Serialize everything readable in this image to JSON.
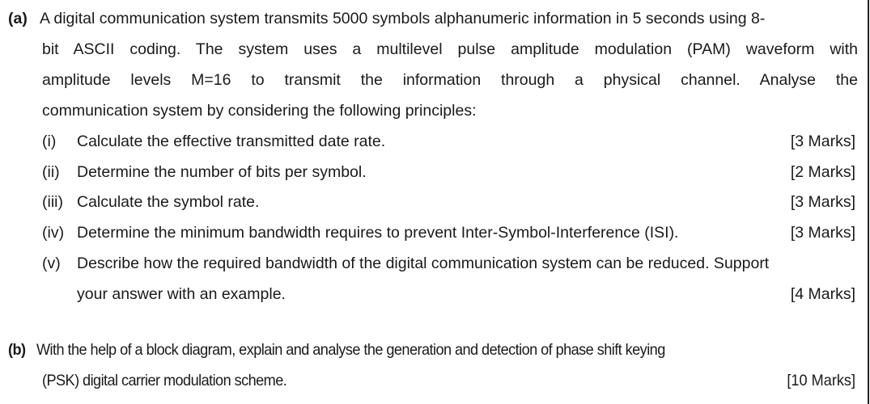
{
  "part_a": {
    "label": "(a)",
    "intro_lines": [
      "A digital communication system transmits 5000 symbols alphanumeric information in 5 seconds using 8-",
      "bit ASCII coding. The system uses a multilevel pulse amplitude modulation (PAM) waveform with",
      "amplitude levels M=16 to transmit the information through a physical channel. Analyse the",
      "communication system by considering the following principles:"
    ],
    "items": [
      {
        "num": "(i)",
        "text": "Calculate the effective transmitted date rate.",
        "marks": "[3 Marks]"
      },
      {
        "num": "(ii)",
        "text": "Determine the number of bits per symbol.",
        "marks": "[2 Marks]"
      },
      {
        "num": "(iii)",
        "text": "Calculate the symbol rate.",
        "marks": "[3 Marks]"
      },
      {
        "num": "(iv)",
        "text": "Determine the minimum bandwidth requires to prevent Inter-Symbol-Interference (ISI).",
        "marks": "[3 Marks]"
      },
      {
        "num": "(v)",
        "text": "Describe how the required bandwidth of the digital communication system can be reduced. Support",
        "text_cont": "your answer with an example.",
        "marks": "[4 Marks]"
      }
    ]
  },
  "part_b": {
    "label": "(b)",
    "line1": "With the help of a block diagram, explain and analyse the generation and detection of phase shift keying",
    "line2": "(PSK) digital carrier modulation scheme.",
    "marks": "[10 Marks]"
  }
}
